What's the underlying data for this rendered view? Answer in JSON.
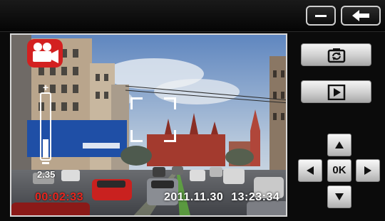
{
  "topbar": {
    "minimize_icon": "minus-icon",
    "back_icon": "back-arrow-icon"
  },
  "preview": {
    "mode_icon": "video-camera-icon",
    "zoom": {
      "plus_label": "+",
      "value": "2.35",
      "level_fraction": 0.3
    },
    "recording_time": "00:02:33",
    "datetime": "2011.11.30  13:23:34",
    "rec_color": "#e8261f"
  },
  "controls": {
    "switch_camera_icon": "camera-switch-icon",
    "play_icon": "play-icon",
    "dpad": {
      "up_icon": "up-triangle-icon",
      "down_icon": "down-triangle-icon",
      "left_icon": "left-triangle-icon",
      "right_icon": "right-triangle-icon",
      "ok_label": "0K"
    }
  }
}
